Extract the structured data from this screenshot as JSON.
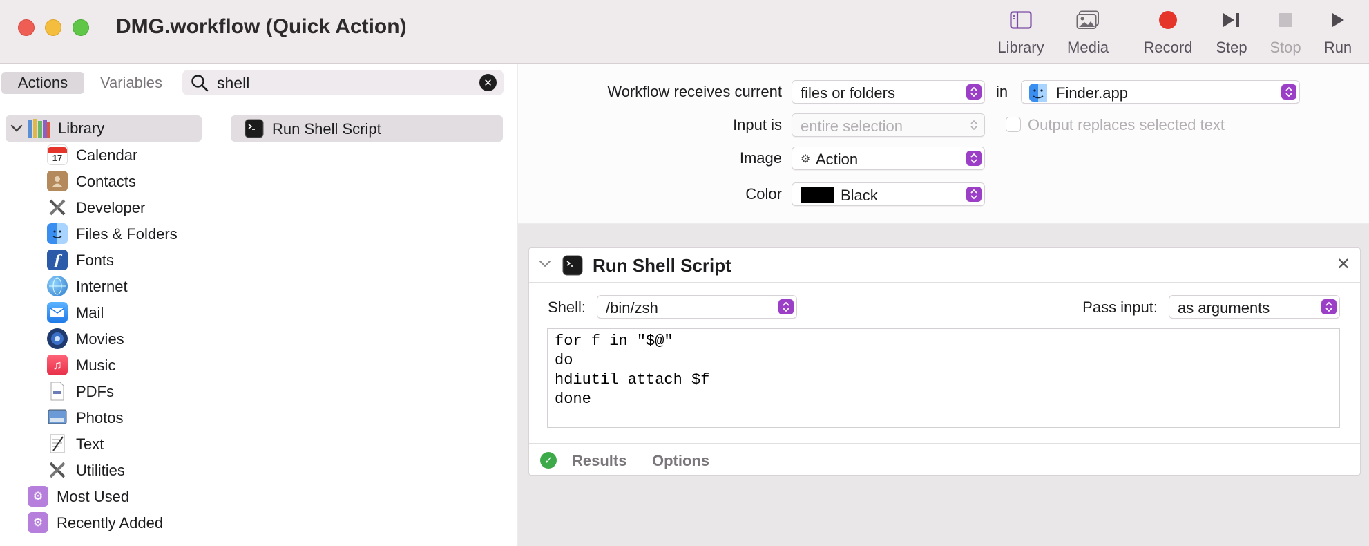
{
  "window": {
    "title": "DMG.workflow (Quick Action)"
  },
  "toolbar": {
    "library": "Library",
    "media": "Media",
    "record": "Record",
    "step": "Step",
    "stop": "Stop",
    "run": "Run"
  },
  "left": {
    "tabs": {
      "actions": "Actions",
      "variables": "Variables"
    },
    "search": {
      "query": "shell"
    },
    "library": {
      "label": "Library",
      "items": [
        {
          "label": "Calendar",
          "icon": "calendar-icon"
        },
        {
          "label": "Contacts",
          "icon": "contacts-icon"
        },
        {
          "label": "Developer",
          "icon": "developer-icon"
        },
        {
          "label": "Files & Folders",
          "icon": "finder-icon"
        },
        {
          "label": "Fonts",
          "icon": "fonts-icon"
        },
        {
          "label": "Internet",
          "icon": "globe-icon"
        },
        {
          "label": "Mail",
          "icon": "mail-icon"
        },
        {
          "label": "Movies",
          "icon": "movies-icon"
        },
        {
          "label": "Music",
          "icon": "music-icon"
        },
        {
          "label": "PDFs",
          "icon": "pdf-icon"
        },
        {
          "label": "Photos",
          "icon": "photos-icon"
        },
        {
          "label": "Text",
          "icon": "text-icon"
        },
        {
          "label": "Utilities",
          "icon": "utilities-icon"
        }
      ],
      "extra": [
        {
          "label": "Most Used",
          "icon": "smart-folder-icon"
        },
        {
          "label": "Recently Added",
          "icon": "smart-folder-icon"
        }
      ]
    },
    "results": [
      {
        "label": "Run Shell Script",
        "icon": "terminal-icon"
      }
    ]
  },
  "workflow": {
    "receives_label": "Workflow receives current",
    "receives_value": "files or folders",
    "in_label": "in",
    "app_value": "Finder.app",
    "input_label": "Input is",
    "input_value": "entire selection",
    "output_replaces": "Output replaces selected text",
    "image_label": "Image",
    "image_value": "Action",
    "color_label": "Color",
    "color_value": "Black"
  },
  "action": {
    "title": "Run Shell Script",
    "shell_label": "Shell:",
    "shell_value": "/bin/zsh",
    "pass_label": "Pass input:",
    "pass_value": "as arguments",
    "script": "for f in \"$@\"\ndo\nhdiutil attach $f\ndone",
    "results_tab": "Results",
    "options_tab": "Options"
  },
  "colors": {
    "accent": "#9b3fc6",
    "record": "#e5352a",
    "ok": "#3daa4a"
  }
}
